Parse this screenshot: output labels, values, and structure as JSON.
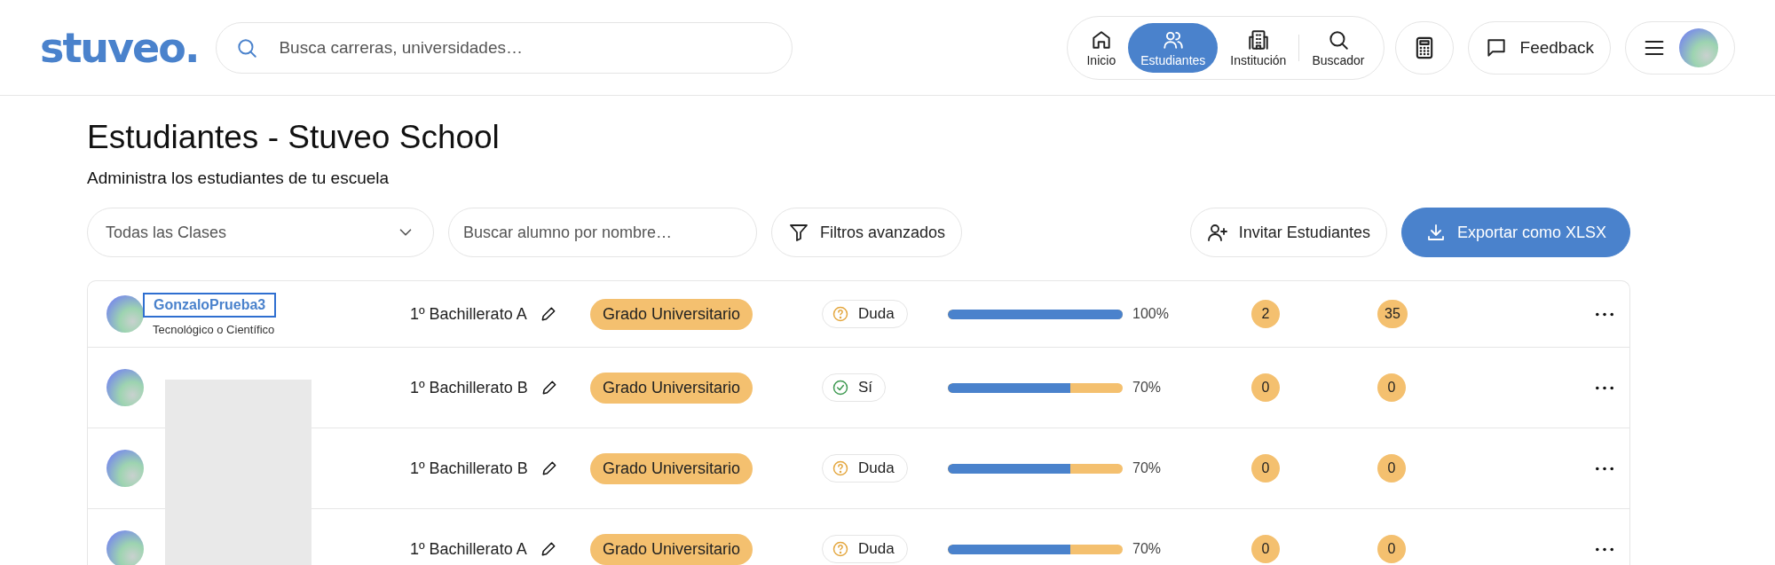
{
  "header": {
    "logo": "stuveo.",
    "search": {
      "placeholder": "Busca carreras, universidades…"
    },
    "nav": [
      {
        "kind": "home",
        "label": "Inicio",
        "selected": false
      },
      {
        "kind": "users",
        "label": "Estudiantes",
        "selected": true
      },
      {
        "kind": "building",
        "label": "Institución",
        "selected": false
      },
      {
        "kind": "search",
        "label": "Buscador",
        "selected": false
      }
    ],
    "feedback": "Feedback"
  },
  "page": {
    "title": "Estudiantes - Stuveo School",
    "subtitle": "Administra los estudiantes de tu escuela"
  },
  "filters": {
    "class_select": "Todas las Clases",
    "student_search": {
      "placeholder": "Buscar alumno por nombre…"
    },
    "advanced": "Filtros avanzados",
    "invite": "Invitar Estudiantes",
    "export": "Exportar como XLSX"
  },
  "rows": [
    {
      "name": "GonzaloPrueba3",
      "profile": "Tecnológico o Científico",
      "focused": true,
      "class": "1º Bachillerato A",
      "goal": "Grado Universitario",
      "status": {
        "kind": "doubt",
        "label": "Duda"
      },
      "level": 1,
      "reading": "100%",
      "count_1": "2",
      "count_2": "35"
    },
    {
      "class": "1º Bachillerato B",
      "goal": "Grado Universitario",
      "status": {
        "kind": "yes",
        "label": "Sí"
      },
      "level": 0.7,
      "reading": "70%",
      "count_1": "0",
      "count_2": "0"
    },
    {
      "class": "1º Bachillerato B",
      "goal": "Grado Universitario",
      "status": {
        "kind": "doubt",
        "label": "Duda"
      },
      "level": 0.7,
      "reading": "70%",
      "count_1": "0",
      "count_2": "0"
    },
    {
      "class": "1º Bachillerato A",
      "goal": "Grado Universitario",
      "status": {
        "kind": "doubt",
        "label": "Duda"
      },
      "level": 0.7,
      "reading": "70%",
      "count_1": "0",
      "count_2": "0"
    }
  ]
}
